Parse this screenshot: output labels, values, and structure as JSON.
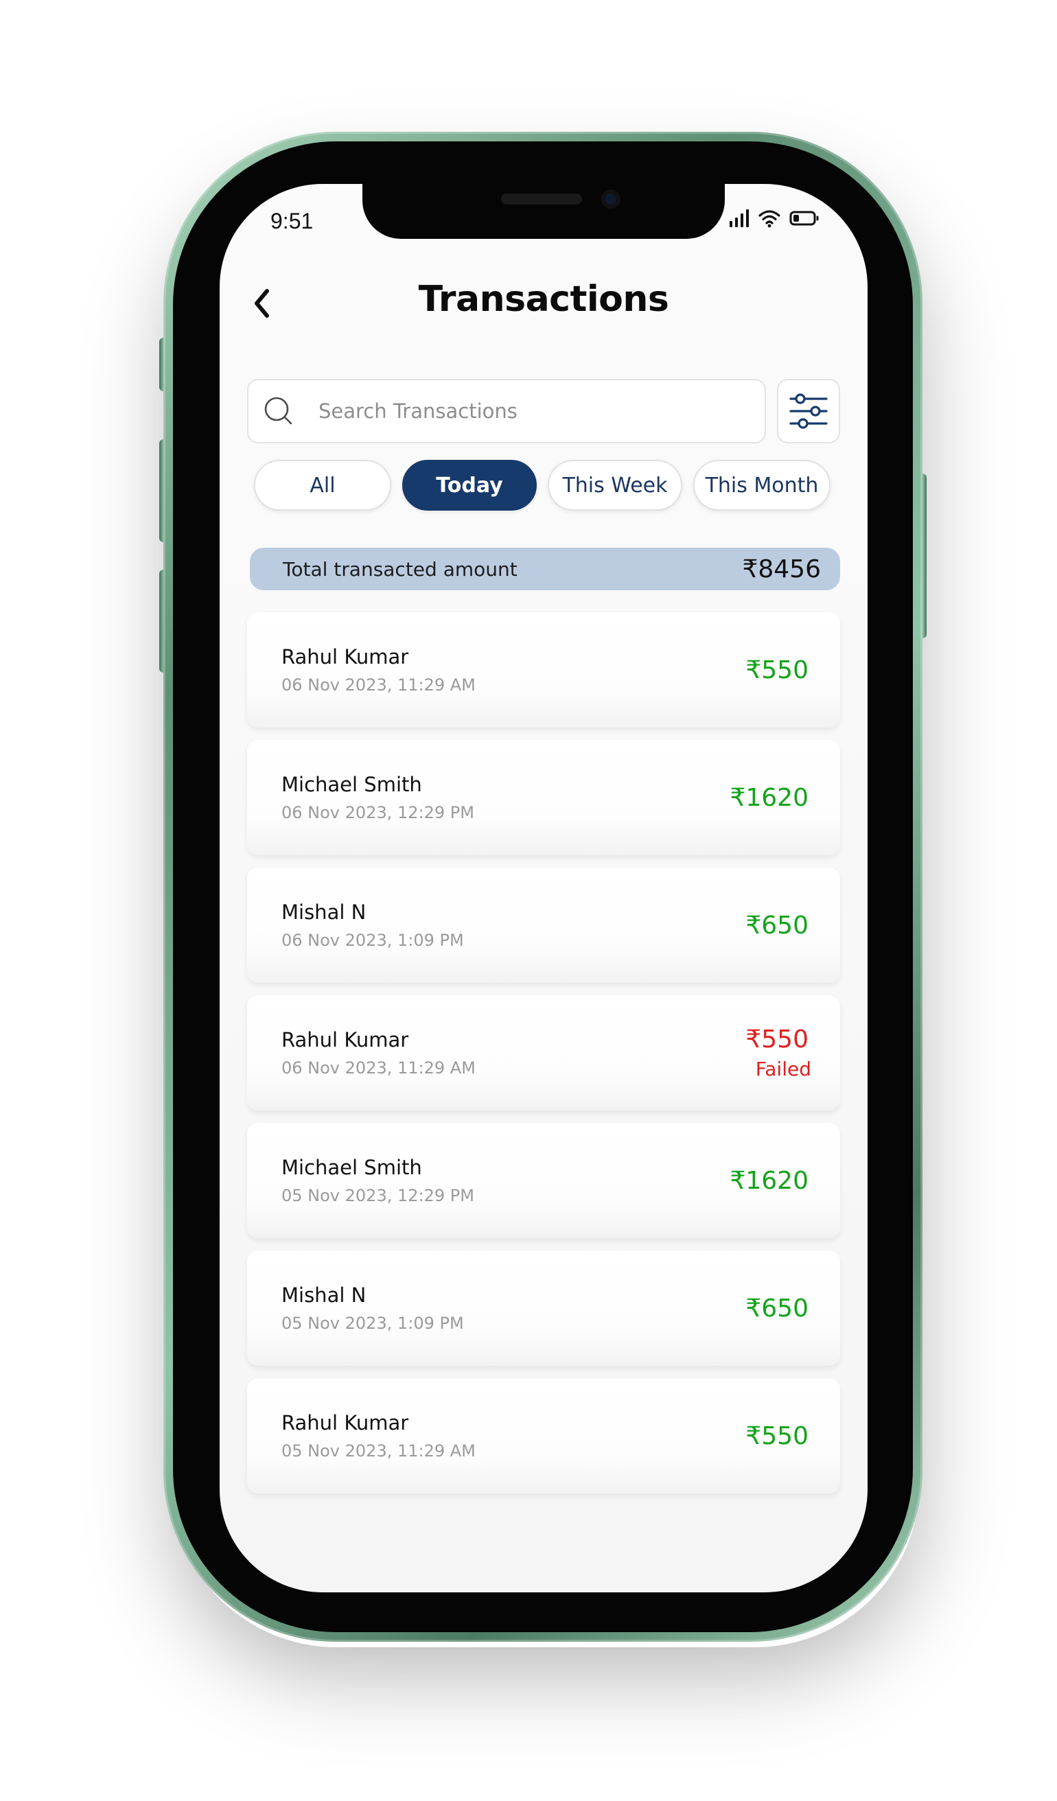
{
  "status_bar": {
    "time": "9:51",
    "icons": [
      "signal-icon",
      "wifi-icon",
      "battery-icon"
    ]
  },
  "header": {
    "back_icon": "chevron-left-icon",
    "title": "Transactions"
  },
  "search": {
    "placeholder": "Search Transactions",
    "value": "",
    "icon": "search-icon",
    "filter_icon": "sliders-icon"
  },
  "filters": {
    "tabs": [
      {
        "label": "All",
        "active": false
      },
      {
        "label": "Today",
        "active": true
      },
      {
        "label": "This Week",
        "active": false
      },
      {
        "label": "This Month",
        "active": false
      }
    ]
  },
  "summary": {
    "label": "Total transacted amount",
    "value": "₹8456"
  },
  "transactions": [
    {
      "name": "Rahul Kumar",
      "date": "06 Nov 2023, 11:29 AM",
      "amount": "₹550",
      "status": ""
    },
    {
      "name": "Michael Smith",
      "date": "06 Nov 2023, 12:29 PM",
      "amount": "₹1620",
      "status": ""
    },
    {
      "name": "Mishal N",
      "date": "06 Nov 2023, 1:09 PM",
      "amount": "₹650",
      "status": ""
    },
    {
      "name": "Rahul Kumar",
      "date": "06 Nov 2023, 11:29 AM",
      "amount": "₹550",
      "status": "Failed"
    },
    {
      "name": "Michael Smith",
      "date": "05 Nov 2023, 12:29 PM",
      "amount": "₹1620",
      "status": ""
    },
    {
      "name": "Mishal N",
      "date": "05 Nov 2023, 1:09 PM",
      "amount": "₹650",
      "status": ""
    },
    {
      "name": "Rahul Kumar",
      "date": "05 Nov 2023, 11:29 AM",
      "amount": "₹550",
      "status": ""
    }
  ],
  "colors": {
    "accent": "#173a6c",
    "success": "#12a319",
    "failed": "#e02020",
    "summary_bg": "#bccce0",
    "phone_frame": "#7fb394"
  }
}
